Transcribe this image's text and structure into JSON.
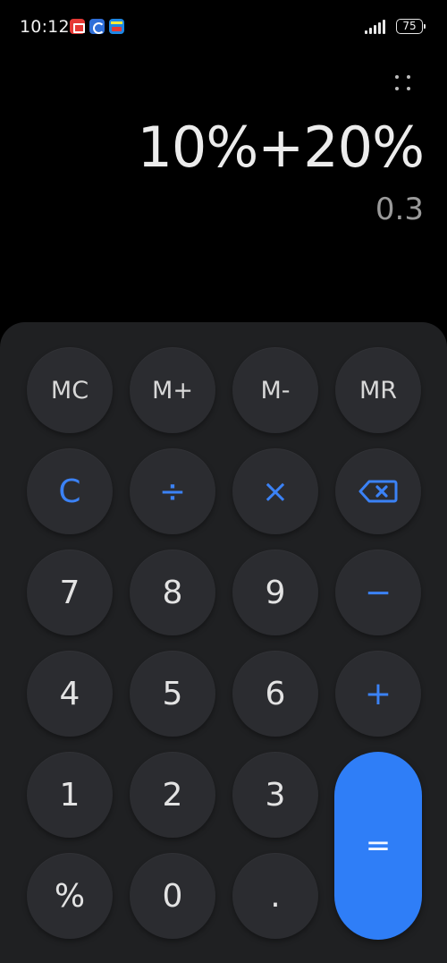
{
  "status_bar": {
    "time": "10:12",
    "battery": "75",
    "notification_icons": [
      "red-app-icon",
      "blue-app-icon",
      "news-app-icon"
    ]
  },
  "display": {
    "expression": "10%+20%",
    "result": "0.3"
  },
  "keypad": {
    "row1": [
      "MC",
      "M+",
      "M-",
      "MR"
    ],
    "row2": [
      "C",
      "÷",
      "×",
      "backspace-icon"
    ],
    "row3": [
      "7",
      "8",
      "9",
      "−"
    ],
    "row4": [
      "4",
      "5",
      "6",
      "+"
    ],
    "row5": [
      "1",
      "2",
      "3"
    ],
    "row6": [
      "%",
      "0",
      "."
    ],
    "equals": "="
  },
  "colors": {
    "accent": "#3b82f6",
    "equals_bg": "#2f7ef7",
    "key_bg": "#2b2c30",
    "keypad_bg": "#1f2022",
    "background": "#000000"
  }
}
